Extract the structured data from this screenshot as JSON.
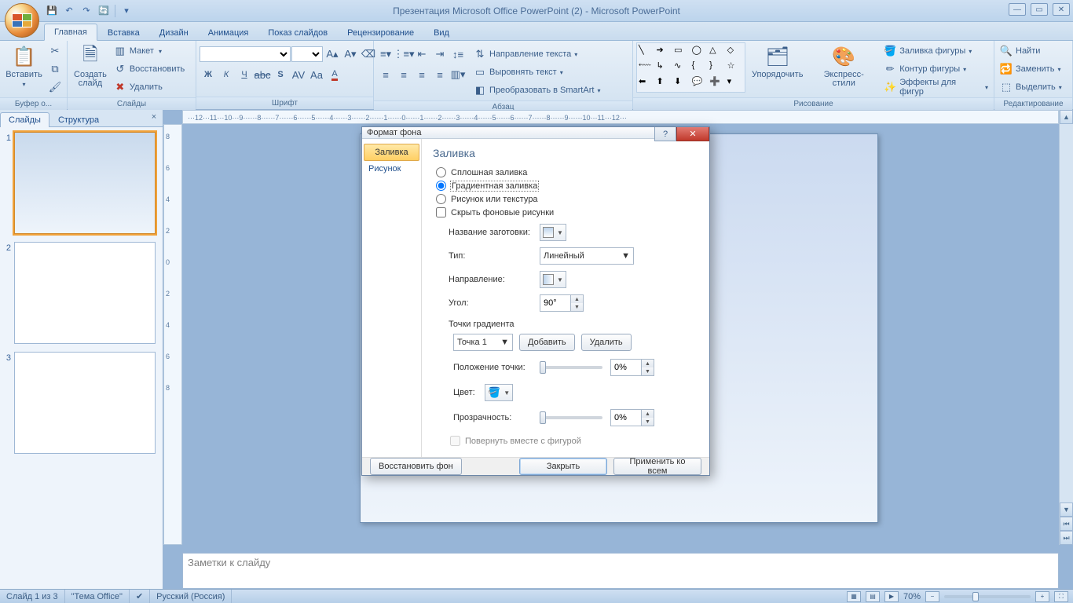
{
  "title": "Презентация Microsoft Office PowerPoint (2) - Microsoft PowerPoint",
  "tabs": [
    "Главная",
    "Вставка",
    "Дизайн",
    "Анимация",
    "Показ слайдов",
    "Рецензирование",
    "Вид"
  ],
  "ribbon": {
    "clipboard": {
      "paste": "Вставить",
      "label": "Буфер о..."
    },
    "slides": {
      "new": "Создать\nслайд",
      "layout": "Макет",
      "reset": "Восстановить",
      "delete": "Удалить",
      "label": "Слайды"
    },
    "font": {
      "label": "Шрифт"
    },
    "para": {
      "label": "Абзац",
      "dir": "Направление текста",
      "align": "Выровнять текст",
      "smart": "Преобразовать в SmartArt"
    },
    "draw": {
      "arrange": "Упорядочить",
      "styles": "Экспресс-стили",
      "fill": "Заливка фигуры",
      "outline": "Контур фигуры",
      "effects": "Эффекты для фигур",
      "label": "Рисование"
    },
    "edit": {
      "find": "Найти",
      "replace": "Заменить",
      "select": "Выделить",
      "label": "Редактирование"
    }
  },
  "panel": {
    "tab1": "Слайды",
    "tab2": "Структура"
  },
  "ruler_h": "⋯12⋯11⋯10⋯9⋯⋯8⋯⋯7⋯⋯6⋯⋯5⋯⋯4⋯⋯3⋯⋯2⋯⋯1⋯⋯0⋯⋯1⋯⋯2⋯⋯3⋯⋯4⋯⋯5⋯⋯6⋯⋯7⋯⋯8⋯⋯9⋯⋯10⋯11⋯12⋯",
  "notes_placeholder": "Заметки к слайду",
  "status": {
    "slide": "Слайд 1 из 3",
    "theme": "\"Тема Office\"",
    "lang": "Русский (Россия)",
    "zoom": "70%"
  },
  "dialog": {
    "title": "Формат фона",
    "nav": [
      "Заливка",
      "Рисунок"
    ],
    "heading": "Заливка",
    "radios": [
      "Сплошная заливка",
      "Градиентная заливка",
      "Рисунок или текстура"
    ],
    "hide_bg": "Скрыть фоновые рисунки",
    "preset": "Название заготовки:",
    "type_lbl": "Тип:",
    "type_val": "Линейный",
    "dir_lbl": "Направление:",
    "angle_lbl": "Угол:",
    "angle_val": "90°",
    "stops_lbl": "Точки градиента",
    "stop_sel": "Точка 1",
    "add": "Добавить",
    "del": "Удалить",
    "pos_lbl": "Положение точки:",
    "pos_val": "0%",
    "color_lbl": "Цвет:",
    "trans_lbl": "Прозрачность:",
    "trans_val": "0%",
    "rotate": "Повернуть вместе с фигурой",
    "restore": "Восстановить фон",
    "close": "Закрыть",
    "apply": "Применить ко всем"
  }
}
